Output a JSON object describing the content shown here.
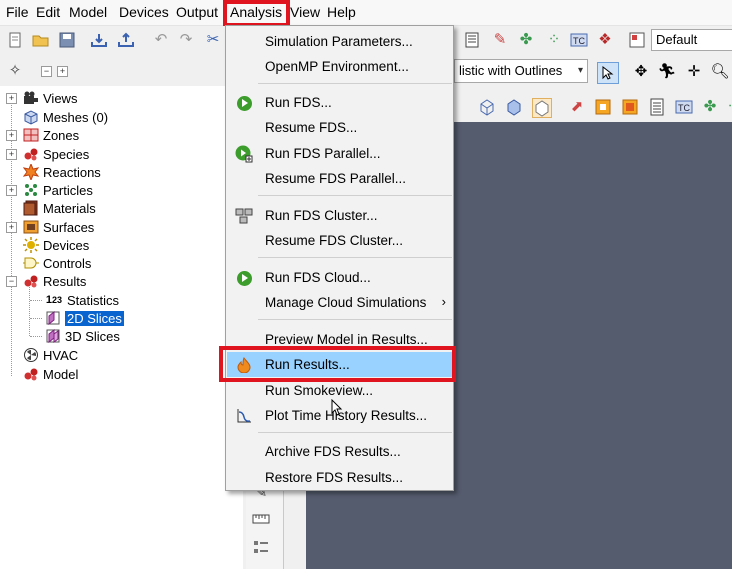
{
  "menubar": {
    "items": [
      "File",
      "Edit",
      "Model",
      "Devices",
      "Output",
      "Analysis",
      "View",
      "Help"
    ]
  },
  "toolbar": {
    "view_combo": "Default",
    "render_combo": "listic with Outlines"
  },
  "tree": {
    "items": [
      {
        "label": "Views"
      },
      {
        "label": "Meshes (0)"
      },
      {
        "label": "Zones"
      },
      {
        "label": "Species"
      },
      {
        "label": "Reactions"
      },
      {
        "label": "Particles"
      },
      {
        "label": "Materials"
      },
      {
        "label": "Surfaces"
      },
      {
        "label": "Devices"
      },
      {
        "label": "Controls"
      },
      {
        "label": "Results"
      },
      {
        "label": "Statistics"
      },
      {
        "label": "2D Slices"
      },
      {
        "label": "3D Slices"
      },
      {
        "label": "HVAC"
      },
      {
        "label": "Model"
      }
    ],
    "statistics_icon_text": "123"
  },
  "dropdown": {
    "items": [
      {
        "label": "Simulation Parameters..."
      },
      {
        "label": "OpenMP Environment..."
      },
      {
        "label": "Run FDS..."
      },
      {
        "label": "Resume FDS..."
      },
      {
        "label": "Run FDS Parallel..."
      },
      {
        "label": "Resume FDS Parallel..."
      },
      {
        "label": "Run FDS Cluster..."
      },
      {
        "label": "Resume FDS Cluster..."
      },
      {
        "label": "Run FDS Cloud..."
      },
      {
        "label": "Manage Cloud Simulations"
      },
      {
        "label": "Preview Model in Results..."
      },
      {
        "label": "Run Results..."
      },
      {
        "label": "Run Smokeview..."
      },
      {
        "label": "Plot Time History Results..."
      },
      {
        "label": "Archive FDS Results..."
      },
      {
        "label": "Restore FDS Results..."
      }
    ],
    "active_item": "Run Results..."
  },
  "colors": {
    "highlight_box": "#e0141e",
    "menu_active": "#99d1ff",
    "tree_selected": "#0a64d0",
    "viewport_bg": "#555c6e"
  }
}
